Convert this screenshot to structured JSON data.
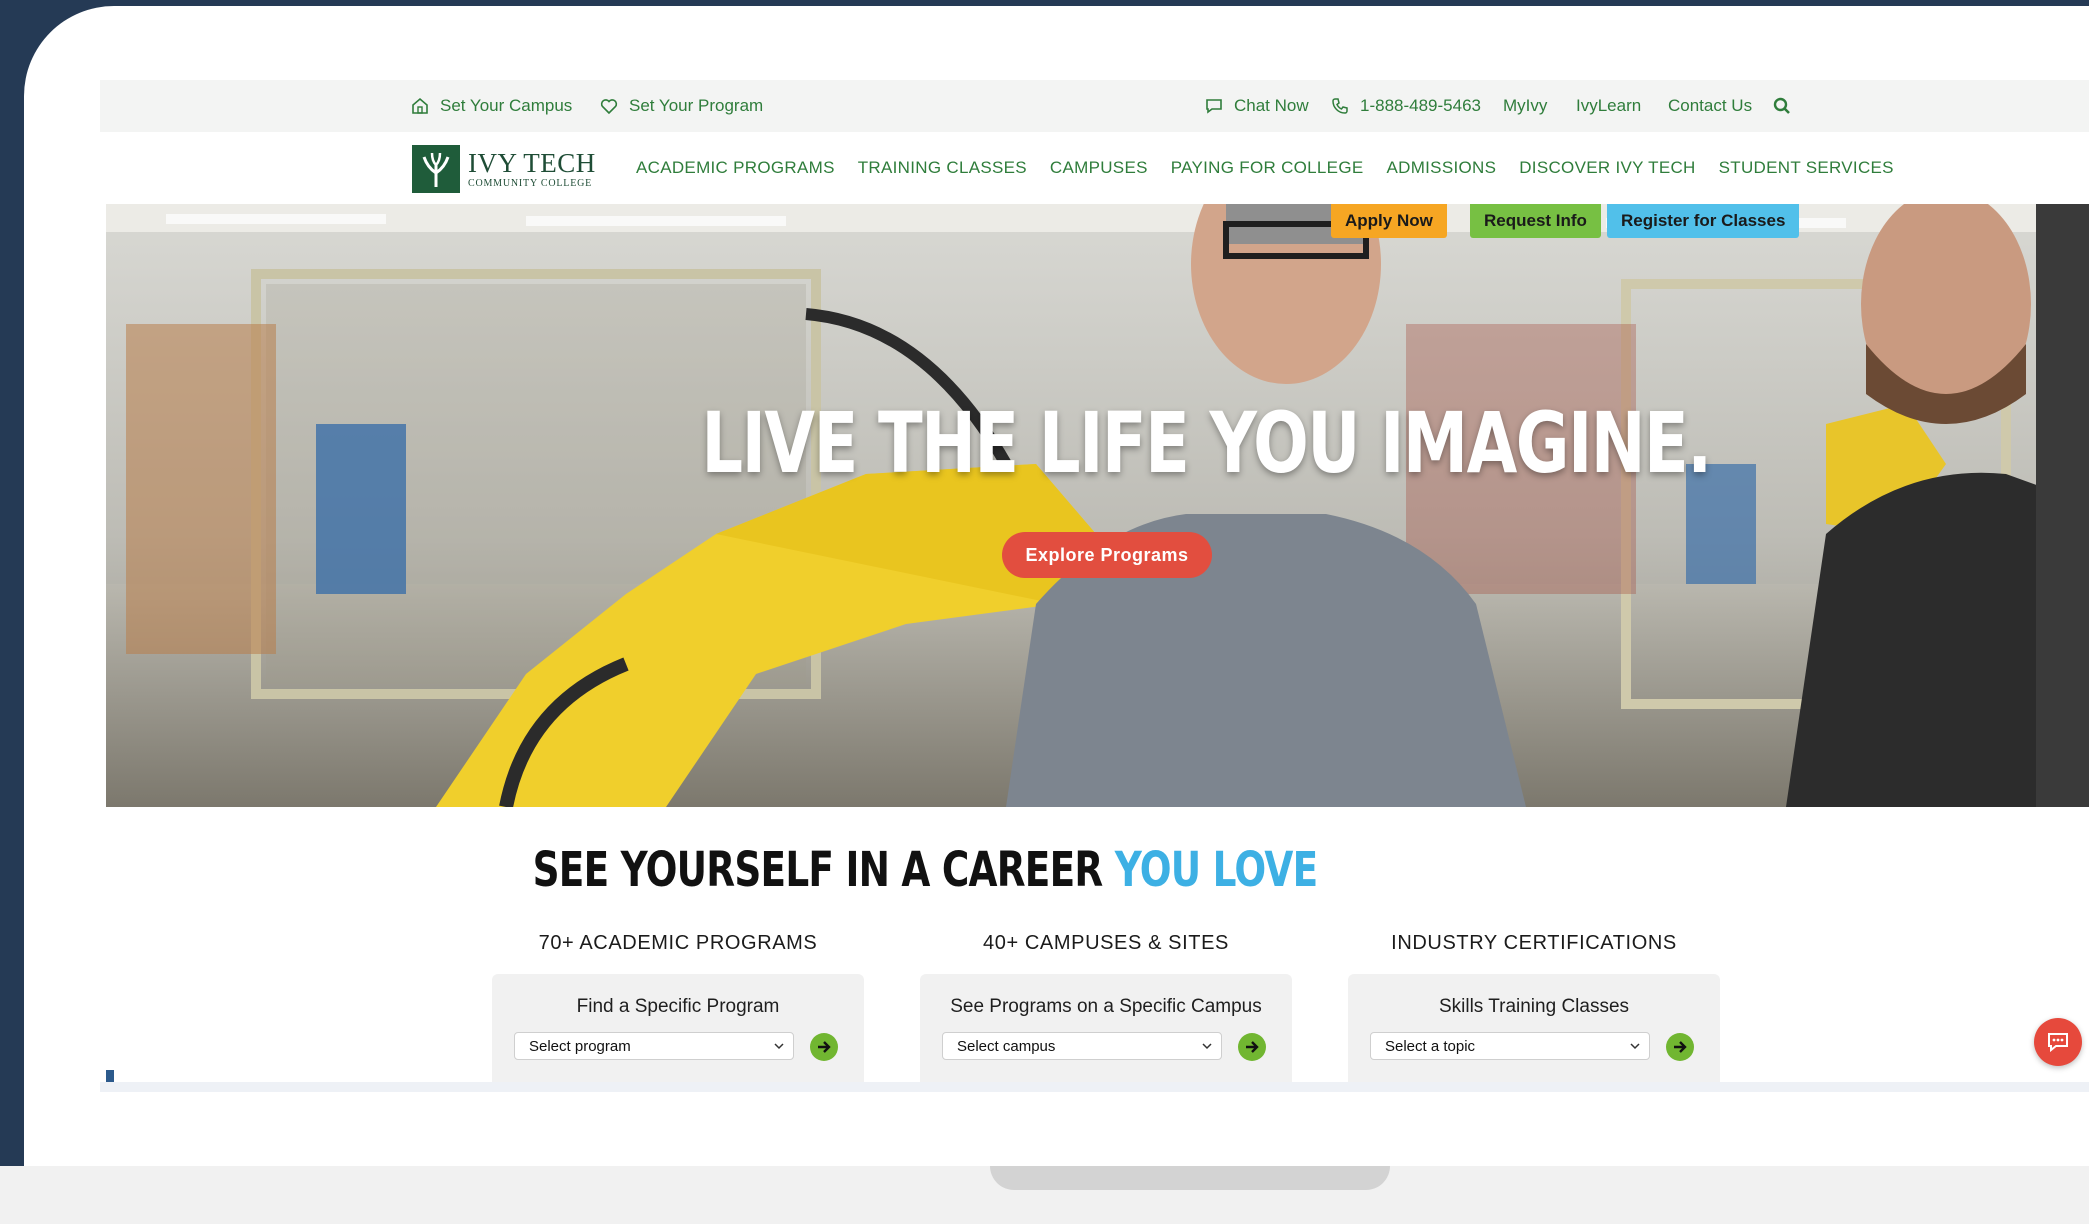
{
  "utility": {
    "set_campus": "Set Your Campus",
    "set_program": "Set Your Program",
    "chat_now": "Chat Now",
    "phone": "1-888-489-5463",
    "myivy": "MyIvy",
    "ivylearn": "IvyLearn",
    "contact_us": "Contact Us"
  },
  "logo": {
    "name": "IVY TECH",
    "sub": "COMMUNITY COLLEGE"
  },
  "nav": {
    "items": [
      "ACADEMIC PROGRAMS",
      "TRAINING CLASSES",
      "CAMPUSES",
      "PAYING FOR COLLEGE",
      "ADMISSIONS",
      "DISCOVER IVY TECH",
      "STUDENT SERVICES"
    ]
  },
  "cta": {
    "apply_now": "Apply Now",
    "request_info": "Request Info",
    "register": "Register for Classes"
  },
  "hero": {
    "title": "LIVE THE LIFE YOU IMAGINE.",
    "button": "Explore Programs"
  },
  "section": {
    "title_dark": "SEE YOURSELF IN A CAREER ",
    "title_accent": "YOU LOVE",
    "columns": [
      {
        "heading": "70+ ACADEMIC PROGRAMS",
        "label": "Find a Specific Program",
        "select": "Select program"
      },
      {
        "heading": "40+ CAMPUSES & SITES",
        "label": "See Programs on a Specific Campus",
        "select": "Select campus"
      },
      {
        "heading": "INDUSTRY CERTIFICATIONS",
        "label": "Skills Training Classes",
        "select": "Select a topic"
      }
    ]
  },
  "colors": {
    "green_text": "#2f7d3b",
    "apply": "#f6a623",
    "request": "#77c043",
    "register": "#51c0ea",
    "explore": "#e24e3f",
    "accent_blue": "#3db0e4",
    "go_green": "#71b631"
  },
  "icons": [
    "home-icon",
    "heart-icon",
    "chat-icon",
    "phone-icon",
    "search-icon",
    "chevron-down-icon",
    "arrow-right-icon",
    "chat-fab-icon"
  ]
}
